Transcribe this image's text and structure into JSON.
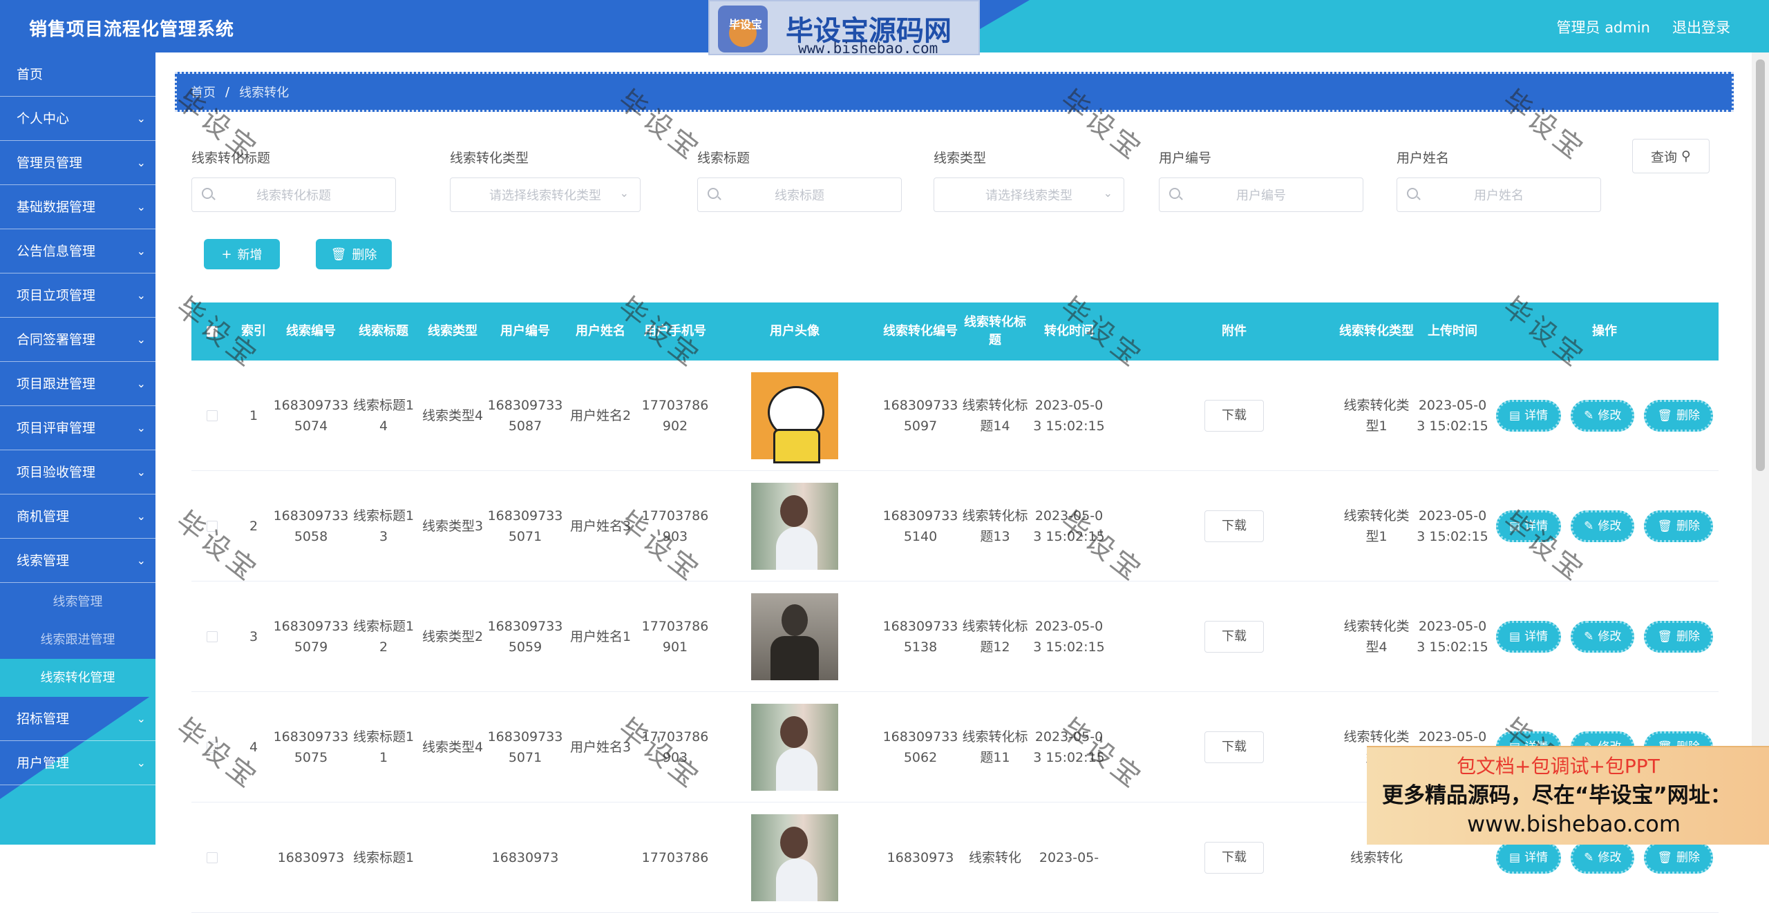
{
  "header": {
    "title": "销售项目流程化管理系统",
    "user": "管理员 admin",
    "logout": "退出登录"
  },
  "watermark_top": {
    "logo_text": "毕设宝",
    "site_name": "毕设宝源码网",
    "url": "www.bishebao.com"
  },
  "sidebar": {
    "items": [
      {
        "label": "首页",
        "chev": false
      },
      {
        "label": "个人中心",
        "chev": true
      },
      {
        "label": "管理员管理",
        "chev": true
      },
      {
        "label": "基础数据管理",
        "chev": true
      },
      {
        "label": "公告信息管理",
        "chev": true
      },
      {
        "label": "项目立项管理",
        "chev": true
      },
      {
        "label": "合同签署管理",
        "chev": true
      },
      {
        "label": "项目跟进管理",
        "chev": true
      },
      {
        "label": "项目评审管理",
        "chev": true
      },
      {
        "label": "项目验收管理",
        "chev": true
      },
      {
        "label": "商机管理",
        "chev": true
      },
      {
        "label": "线索管理",
        "chev": true
      }
    ],
    "subitems": [
      "线索管理",
      "线索跟进管理",
      "线索转化管理"
    ],
    "items_after": [
      {
        "label": "招标管理",
        "chev": true
      },
      {
        "label": "用户管理",
        "chev": true
      }
    ]
  },
  "breadcrumb": {
    "home": "首页",
    "current": "线索转化"
  },
  "filters": [
    {
      "label": "线索转化标题",
      "placeholder": "线索转化标题",
      "type": "text"
    },
    {
      "label": "线索转化类型",
      "placeholder": "请选择线索转化类型",
      "type": "select"
    },
    {
      "label": "线索标题",
      "placeholder": "线索标题",
      "type": "text"
    },
    {
      "label": "线索类型",
      "placeholder": "请选择线索类型",
      "type": "select"
    },
    {
      "label": "用户编号",
      "placeholder": "用户编号",
      "type": "text"
    },
    {
      "label": "用户姓名",
      "placeholder": "用户姓名",
      "type": "text"
    }
  ],
  "buttons": {
    "query": "查询",
    "add": "新增",
    "delete": "删除"
  },
  "table": {
    "headers": [
      "索引",
      "线索编号",
      "线索标题",
      "线索类型",
      "用户编号",
      "用户姓名",
      "用户手机号",
      "用户头像",
      "线索转化编号",
      "线索转化标题",
      "转化时间",
      "附件",
      "线索转化类型",
      "上传时间",
      "操作"
    ],
    "row_actions": {
      "download": "下载",
      "detail": "详情",
      "edit": "修改",
      "delete": "删除"
    },
    "rows": [
      {
        "index": "1",
        "clue_no": "1683097335074",
        "clue_title": "线索标题14",
        "clue_type": "线索类型4",
        "user_no": "1683097335087",
        "user_name": "用户姓名2",
        "phone": "17703786902",
        "avatar": "cartoon",
        "conv_no": "1683097335097",
        "conv_title": "线索转化标题14",
        "conv_time": "2023-05-03 15:02:15",
        "conv_type": "线索转化类型1",
        "upload_time": "2023-05-03 15:02:15"
      },
      {
        "index": "2",
        "clue_no": "1683097335058",
        "clue_title": "线索标题13",
        "clue_type": "线索类型3",
        "user_no": "1683097335071",
        "user_name": "用户姓名3",
        "phone": "17703786903",
        "avatar": "girl",
        "conv_no": "1683097335140",
        "conv_title": "线索转化标题13",
        "conv_time": "2023-05-03 15:02:15",
        "conv_type": "线索转化类型1",
        "upload_time": "2023-05-03 15:02:15"
      },
      {
        "index": "3",
        "clue_no": "1683097335079",
        "clue_title": "线索标题12",
        "clue_type": "线索类型2",
        "user_no": "1683097335059",
        "user_name": "用户姓名1",
        "phone": "17703786901",
        "avatar": "man",
        "conv_no": "1683097335138",
        "conv_title": "线索转化标题12",
        "conv_time": "2023-05-03 15:02:15",
        "conv_type": "线索转化类型4",
        "upload_time": "2023-05-03 15:02:15"
      },
      {
        "index": "4",
        "clue_no": "1683097335075",
        "clue_title": "线索标题11",
        "clue_type": "线索类型4",
        "user_no": "1683097335071",
        "user_name": "用户姓名3",
        "phone": "17703786903",
        "avatar": "girl",
        "conv_no": "1683097335062",
        "conv_title": "线索转化标题11",
        "conv_time": "2023-05-03 15:02:15",
        "conv_type": "线索转化类型4",
        "upload_time": "2023-05-03 15:02:15"
      },
      {
        "index": "",
        "clue_no": "16830973",
        "clue_title": "线索标题1",
        "clue_type": "",
        "user_no": "16830973",
        "user_name": "",
        "phone": "17703786",
        "avatar": "girl",
        "conv_no": "16830973",
        "conv_title": "线索转化",
        "conv_time": "2023-05-",
        "conv_type": "线索转化",
        "upload_time": ""
      }
    ]
  },
  "watermark_text": "毕设宝",
  "ad": {
    "line1": "包文档+包调试+包PPT",
    "line2": "更多精品源码，尽在“毕设宝”网址：",
    "line3": "www.bishebao.com"
  },
  "colors": {
    "primary": "#2b6bd0",
    "accent": "#2bbcd8"
  }
}
